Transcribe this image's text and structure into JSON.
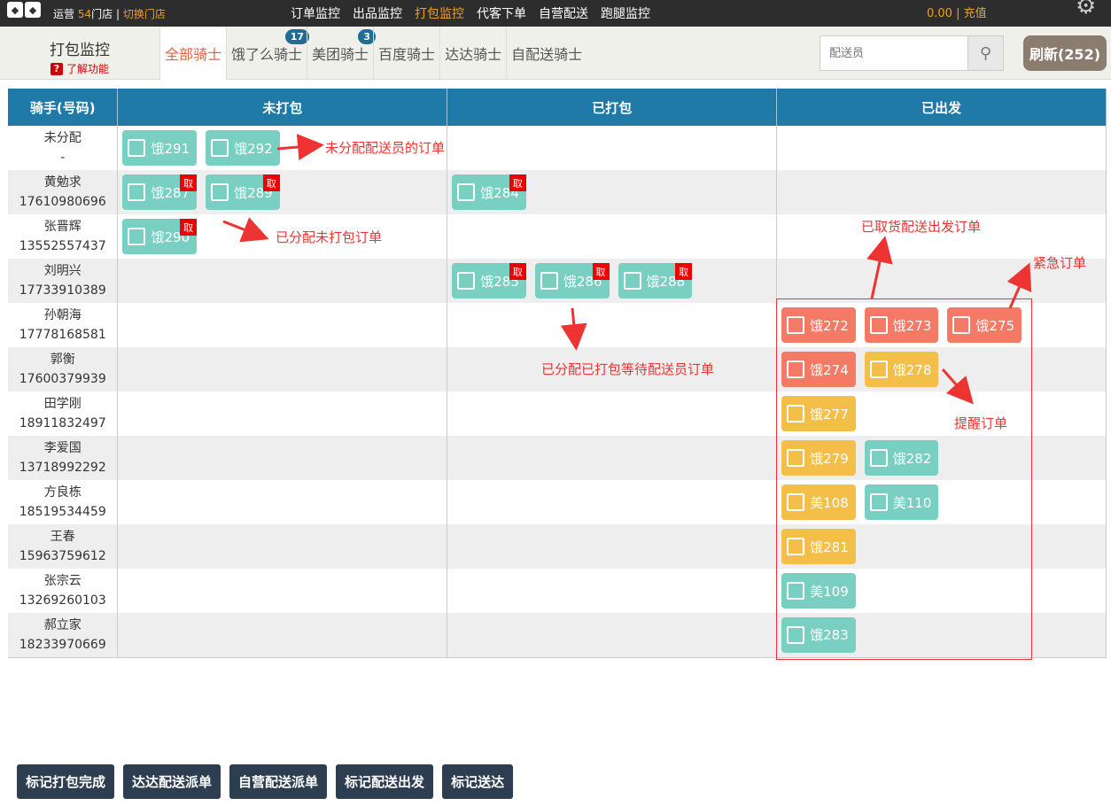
{
  "topbar": {
    "store_prefix": "运营",
    "store_count": "54",
    "store_suffix": "门店 |",
    "switch": "切换门店",
    "nav": [
      "订单监控",
      "出品监控",
      "打包监控",
      "代客下单",
      "自营配送",
      "跑腿监控"
    ],
    "active_nav": 2,
    "balance": "0.00 | 充值"
  },
  "header": {
    "title": "打包监控",
    "learn": "了解功能"
  },
  "tabs": [
    {
      "label": "全部骑士",
      "count": ""
    },
    {
      "label": "饿了么骑士",
      "count": "17"
    },
    {
      "label": "美团骑士",
      "count": "3"
    },
    {
      "label": "百度骑士",
      "count": ""
    },
    {
      "label": "达达骑士",
      "count": ""
    },
    {
      "label": "自配送骑士",
      "count": ""
    }
  ],
  "search": {
    "placeholder": "配送员"
  },
  "refresh": "刷新(252)",
  "table": {
    "headers": [
      "骑手(号码)",
      "未打包",
      "已打包",
      "已出发"
    ],
    "rows": [
      {
        "name": "未分配",
        "phone": "-",
        "unpacked": [
          {
            "id": "饿291",
            "c": "green"
          },
          {
            "id": "饿292",
            "c": "green"
          }
        ],
        "packed": [],
        "departed": []
      },
      {
        "name": "黄勉求",
        "phone": "17610980696",
        "unpacked": [
          {
            "id": "饿287",
            "c": "green",
            "q": "取"
          },
          {
            "id": "饿289",
            "c": "green",
            "q": "取"
          }
        ],
        "packed": [
          {
            "id": "饿284",
            "c": "green",
            "q": "取"
          }
        ],
        "departed": []
      },
      {
        "name": "张晋辉",
        "phone": "13552557437",
        "unpacked": [
          {
            "id": "饿290",
            "c": "green",
            "q": "取"
          }
        ],
        "packed": [],
        "departed": []
      },
      {
        "name": "刘明兴",
        "phone": "17733910389",
        "unpacked": [],
        "packed": [
          {
            "id": "饿285",
            "c": "green",
            "q": "取"
          },
          {
            "id": "饿286",
            "c": "green",
            "q": "取"
          },
          {
            "id": "饿288",
            "c": "green",
            "q": "取"
          }
        ],
        "departed": []
      },
      {
        "name": "孙朝海",
        "phone": "17778168581",
        "unpacked": [],
        "packed": [],
        "departed": [
          {
            "id": "饿272",
            "c": "red"
          },
          {
            "id": "饿273",
            "c": "red"
          },
          {
            "id": "饿275",
            "c": "red"
          }
        ]
      },
      {
        "name": "郭衡",
        "phone": "17600379939",
        "unpacked": [],
        "packed": [],
        "departed": [
          {
            "id": "饿274",
            "c": "red"
          },
          {
            "id": "饿278",
            "c": "yellow"
          }
        ]
      },
      {
        "name": "田学刚",
        "phone": "18911832497",
        "unpacked": [],
        "packed": [],
        "departed": [
          {
            "id": "饿277",
            "c": "yellow"
          }
        ]
      },
      {
        "name": "李爱国",
        "phone": "13718992292",
        "unpacked": [],
        "packed": [],
        "departed": [
          {
            "id": "饿279",
            "c": "yellow"
          },
          {
            "id": "饿282",
            "c": "green"
          }
        ]
      },
      {
        "name": "方良栋",
        "phone": "18519534459",
        "unpacked": [],
        "packed": [],
        "departed": [
          {
            "id": "美108",
            "c": "yellow"
          },
          {
            "id": "美110",
            "c": "green"
          }
        ]
      },
      {
        "name": "王春",
        "phone": "15963759612",
        "unpacked": [],
        "packed": [],
        "departed": [
          {
            "id": "饿281",
            "c": "yellow"
          }
        ]
      },
      {
        "name": "张宗云",
        "phone": "13269260103",
        "unpacked": [],
        "packed": [],
        "departed": [
          {
            "id": "美109",
            "c": "green"
          }
        ]
      },
      {
        "name": "郝立家",
        "phone": "18233970669",
        "unpacked": [],
        "packed": [],
        "departed": [
          {
            "id": "饿283",
            "c": "green"
          }
        ]
      }
    ]
  },
  "annotations": {
    "a1": "未分配配送员的订单",
    "a2": "已分配未打包订单",
    "a3": "已分配已打包等待配送员订单",
    "a4": "已取货配送出发订单",
    "a5": "紧急订单",
    "a6": "提醒订单"
  },
  "actions": [
    "标记打包完成",
    "达达配送派单",
    "自营配送派单",
    "标记配送出发",
    "标记送达"
  ]
}
